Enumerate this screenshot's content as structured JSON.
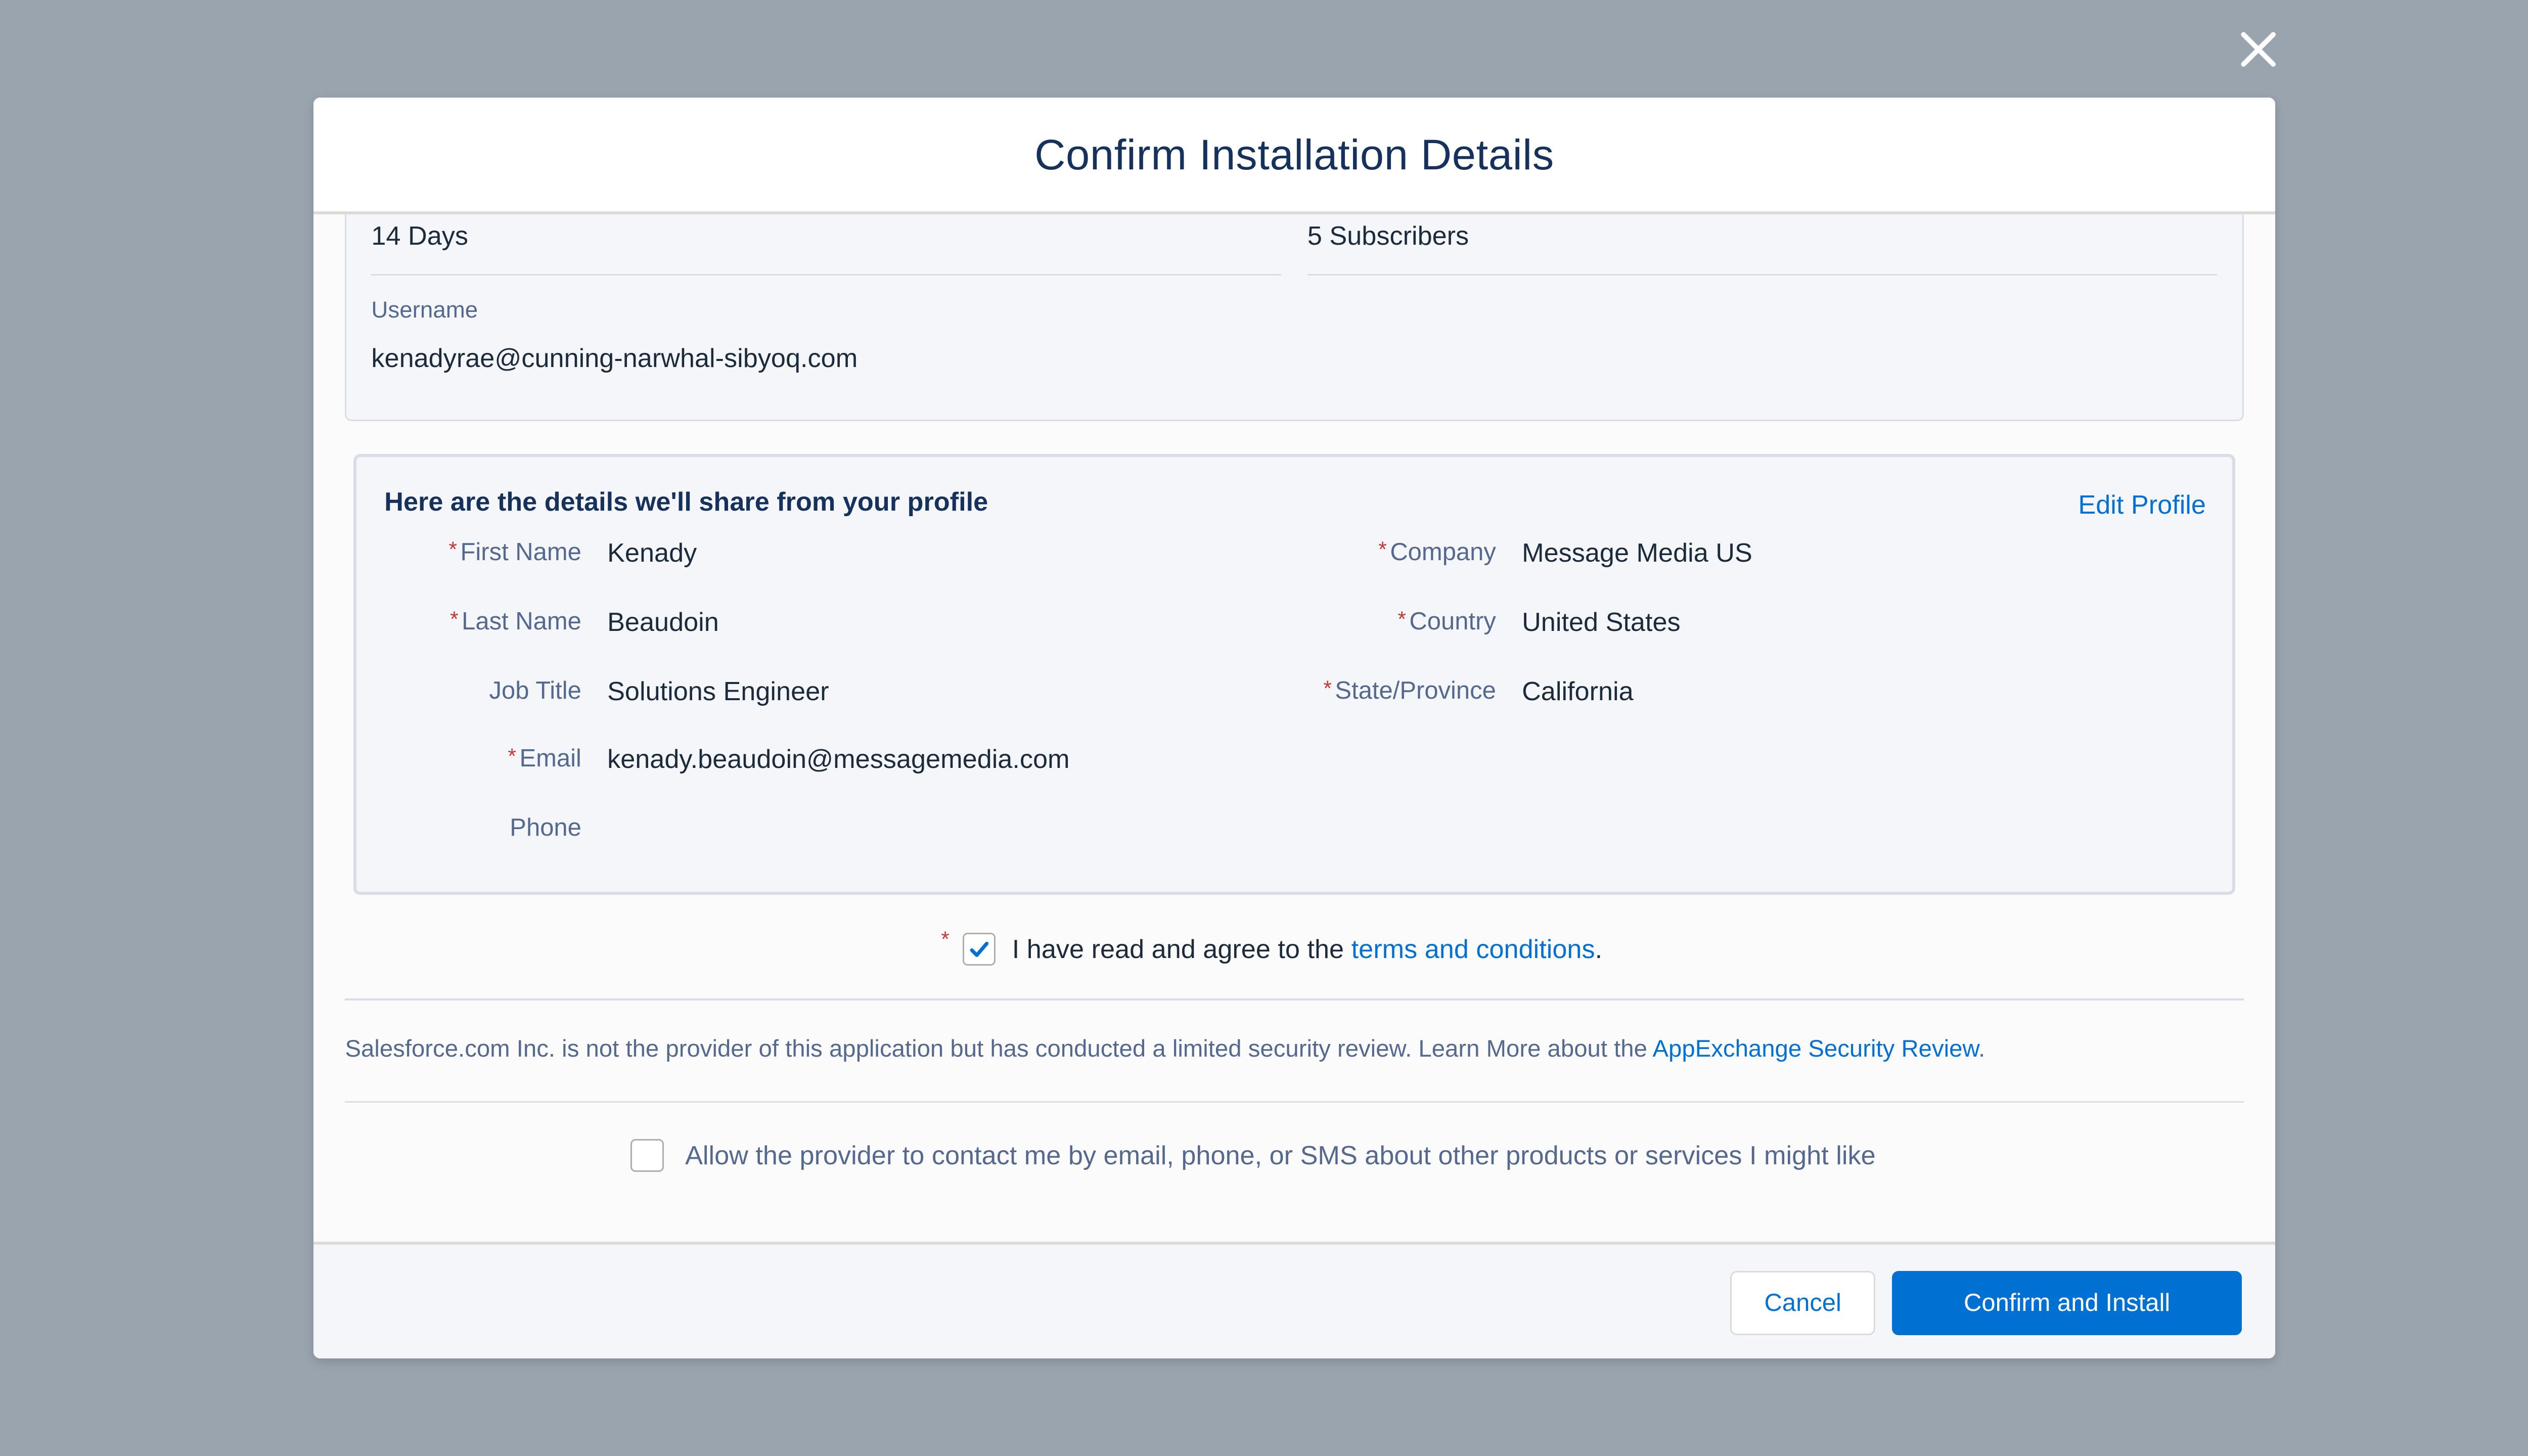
{
  "modal": {
    "title": "Confirm Installation Details",
    "close_icon": "close-icon"
  },
  "license": {
    "duration_value": "14 Days",
    "seats_value": "5 Subscribers",
    "username_label": "Username",
    "username_value": "kenadyrae@cunning-narwhal-sibyoq.com"
  },
  "profile": {
    "heading": "Here are the details we'll share from your profile",
    "edit_link": "Edit Profile",
    "required_marker": "*",
    "left_fields": [
      {
        "label": "First Name",
        "value": "Kenady",
        "required": true
      },
      {
        "label": "Last Name",
        "value": "Beaudoin",
        "required": true
      },
      {
        "label": "Job Title",
        "value": "Solutions Engineer",
        "required": false
      },
      {
        "label": "Email",
        "value": "kenady.beaudoin@messagemedia.com",
        "required": true
      },
      {
        "label": "Phone",
        "value": "",
        "required": false
      }
    ],
    "right_fields": [
      {
        "label": "Company",
        "value": "Message Media US",
        "required": true
      },
      {
        "label": "Country",
        "value": "United States",
        "required": true
      },
      {
        "label": "State/Province",
        "value": "California",
        "required": true
      }
    ]
  },
  "terms": {
    "checked": true,
    "text_before": "I have read and agree to the ",
    "link_text": "terms and conditions",
    "text_after": "."
  },
  "security_notice": {
    "text": "Salesforce.com Inc. is not the provider of this application but has conducted a limited security review. Learn More about the ",
    "link_text": "AppExchange Security Review",
    "text_after": "."
  },
  "contact_optin": {
    "checked": false,
    "label": "Allow the provider to contact me by email, phone, or SMS about other products or services I might like"
  },
  "footer": {
    "cancel_label": "Cancel",
    "confirm_label": "Confirm and Install"
  },
  "colors": {
    "overlay": "#99a4af",
    "brand": "#0070d2",
    "required": "#c23934",
    "text_primary": "#16325c",
    "text_secondary": "#54698d"
  }
}
